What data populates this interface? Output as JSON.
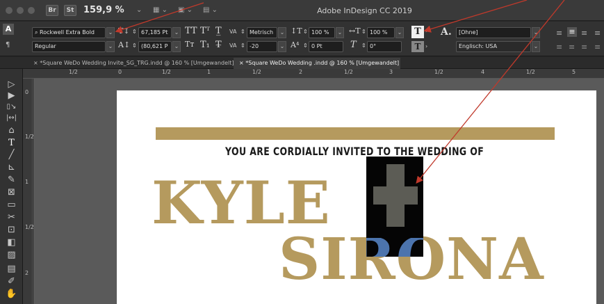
{
  "window": {
    "app_title": "Adobe InDesign CC 2019",
    "zoom": "159,9 %",
    "bridge_label": "Br",
    "stock_label": "St"
  },
  "control_bar": {
    "font_family": "Rockwell Extra Bold",
    "font_style": "Regular",
    "font_size": "67,185 Pt",
    "leading": "(80,621 P",
    "kerning": "Metrisch",
    "tracking": "-20",
    "vertical_scale": "100 %",
    "horizontal_scale": "100 %",
    "baseline_shift": "0 Pt",
    "skew": "0°",
    "char_style": "[Ohne]",
    "language": "Englisch: USA",
    "char_style_prefix": "A."
  },
  "tabs": [
    {
      "label": "*Square WeDo Wedding Invite_SG_TRG.indd @ 160 % [Umgewandelt]",
      "active": false
    },
    {
      "label": "*Square WeDo Wedding .indd @ 160 % [Umgewandelt]",
      "active": true
    }
  ],
  "ruler": {
    "top": [
      "1/2",
      "0",
      "1/2",
      "1",
      "1/2",
      "2",
      "1/2",
      "3",
      "1/2",
      "4",
      "1/2",
      "5"
    ],
    "left": [
      "0",
      "1/2",
      "1",
      "1/2",
      "2"
    ]
  },
  "document": {
    "invite_line": "YOU ARE CORDIALLY INVITED TO THE WEDDING OF",
    "name1": "KYLE",
    "name2": "SIRONA",
    "gold_color": "#b59a5e",
    "blue_color": "#4c74ad",
    "arrow_color": "#c0392b"
  }
}
